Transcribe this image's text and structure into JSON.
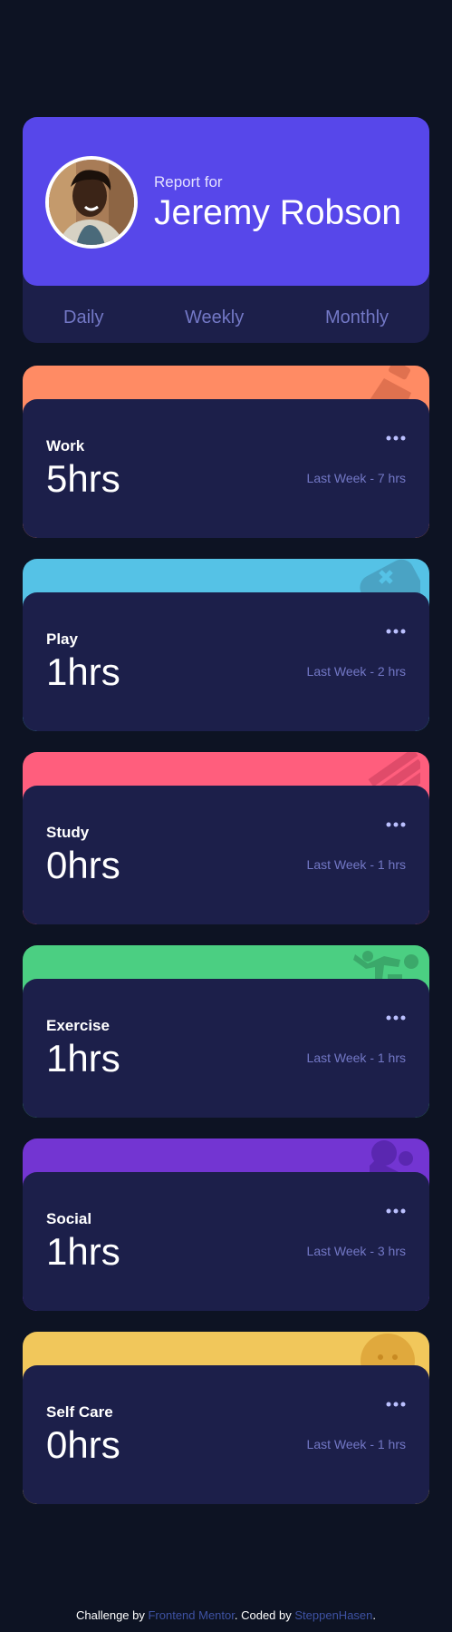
{
  "profile": {
    "report_label": "Report for",
    "name": "Jeremy Robson",
    "tabs": [
      "Daily",
      "Weekly",
      "Monthly"
    ]
  },
  "cards": [
    {
      "title": "Work",
      "hours": "5hrs",
      "previous": "Last Week - 7 hrs",
      "color": "#ff8b64",
      "icon": "work-icon"
    },
    {
      "title": "Play",
      "hours": "1hrs",
      "previous": "Last Week - 2 hrs",
      "color": "#55c2e6",
      "icon": "play-icon"
    },
    {
      "title": "Study",
      "hours": "0hrs",
      "previous": "Last Week - 1 hrs",
      "color": "#ff5e7d",
      "icon": "study-icon"
    },
    {
      "title": "Exercise",
      "hours": "1hrs",
      "previous": "Last Week - 1 hrs",
      "color": "#4bcf82",
      "icon": "exercise-icon"
    },
    {
      "title": "Social",
      "hours": "1hrs",
      "previous": "Last Week - 3 hrs",
      "color": "#7335d2",
      "icon": "social-icon"
    },
    {
      "title": "Self Care",
      "hours": "0hrs",
      "previous": "Last Week - 1 hrs",
      "color": "#f1c75b",
      "icon": "self-care-icon"
    }
  ],
  "footer": {
    "prefix": "Challenge by ",
    "link1": "Frontend Mentor",
    "middle": ". Coded by ",
    "link2": "SteppenHasen",
    "suffix": "."
  }
}
